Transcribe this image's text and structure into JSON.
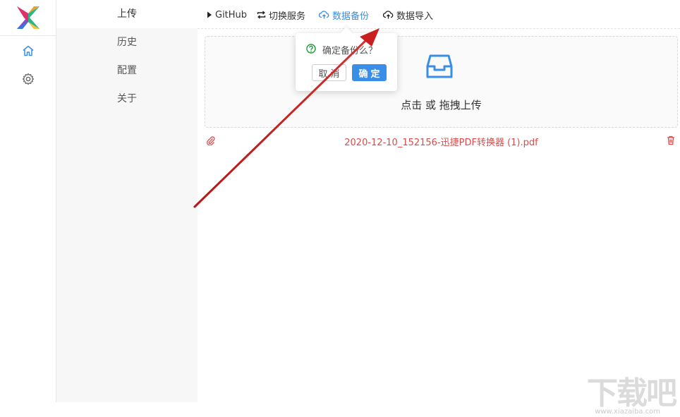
{
  "rail": {
    "logo_icon": "colorful-x-logo",
    "items": [
      {
        "icon": "home-icon"
      },
      {
        "icon": "gear-icon"
      }
    ]
  },
  "nav": {
    "items": [
      {
        "label": "上传",
        "active": true
      },
      {
        "label": "历史",
        "active": false
      },
      {
        "label": "配置",
        "active": false
      },
      {
        "label": "关于",
        "active": false
      }
    ]
  },
  "toolbar": {
    "github": "GitHub",
    "switch_service": "切换服务",
    "backup": "数据备份",
    "import": "数据导入"
  },
  "upload": {
    "prompt": "点击 或 拖拽上传"
  },
  "files": [
    {
      "name": "2020-12-10_152156-迅捷PDF转换器 (1).pdf"
    }
  ],
  "popconfirm": {
    "message": "确定备份么？",
    "cancel": "取消",
    "ok": "确定"
  },
  "watermark": {
    "logo": "下载吧",
    "url": "www.xiazaiba.com"
  },
  "colors": {
    "accent": "#3a8ee6",
    "file_text": "#d94c4c",
    "annotation_arrow": "#c91f1f"
  }
}
